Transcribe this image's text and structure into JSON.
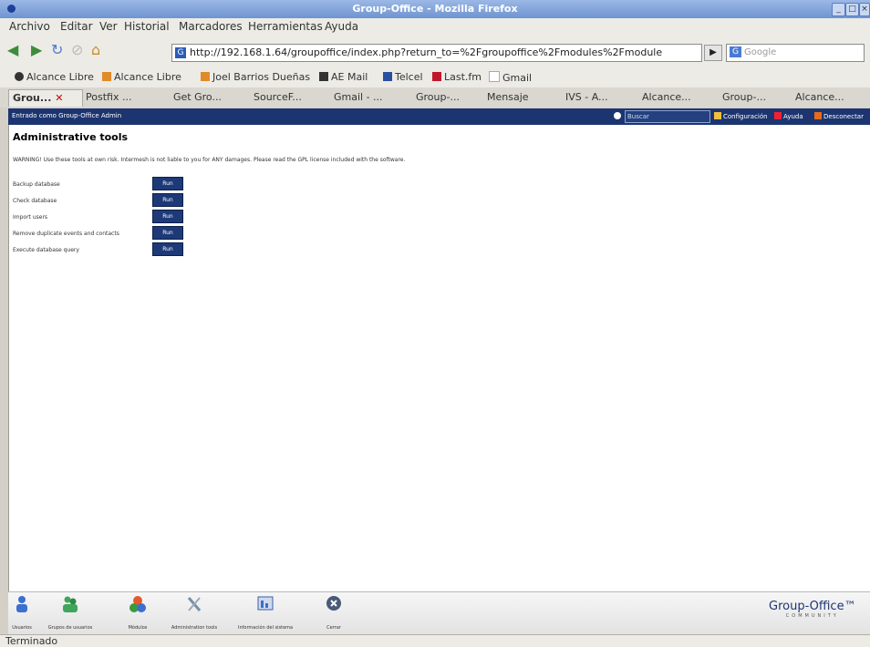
{
  "window": {
    "title": "Group-Office - Mozilla Firefox"
  },
  "menu": [
    "Archivo",
    "Editar",
    "Ver",
    "Historial",
    "Marcadores",
    "Herramientas",
    "Ayuda"
  ],
  "nav": {
    "url": "http://192.168.1.64/groupoffice/index.php?return_to=%2Fgroupoffice%2Fmodules%2Fmodule",
    "search_placeholder": "Google"
  },
  "bookmarks": [
    "Alcance Libre",
    "Alcance Libre",
    "Joel Barrios Dueñas",
    "AE Mail",
    "Telcel",
    "Last.fm",
    "Gmail"
  ],
  "tabs": [
    "Grou...",
    "Postfix ...",
    "Get Gro...",
    "SourceF...",
    "Gmail - ...",
    "Group-...",
    "Mensaje",
    "IVS - A...",
    "Alcance...",
    "Group-...",
    "Alcance..."
  ],
  "app": {
    "logged_in": "Entrado como Group-Office Admin",
    "search_placeholder": "Buscar",
    "links": {
      "settings": "Configuración",
      "help": "Ayuda",
      "logout": "Desconectar"
    }
  },
  "page": {
    "title": "Administrative tools",
    "warning": "WARNING! Use these tools at own risk. Intermesh is not liable to you for ANY damages. Please read the GPL license included with the software.",
    "run_label": "Run",
    "tools": [
      "Backup database",
      "Check database",
      "Import users",
      "Remove duplicate events and contacts",
      "Execute database query"
    ]
  },
  "modules": [
    "Usuarios",
    "Grupos de usuarios",
    "Módulos",
    "Administration tools",
    "Información del sistema",
    "Cerrar"
  ],
  "logo": {
    "name": "Group-Office™",
    "sub": "COMMUNITY"
  },
  "status": "Terminado",
  "colors": {
    "header": "#1c3570",
    "button": "#1e3978"
  }
}
